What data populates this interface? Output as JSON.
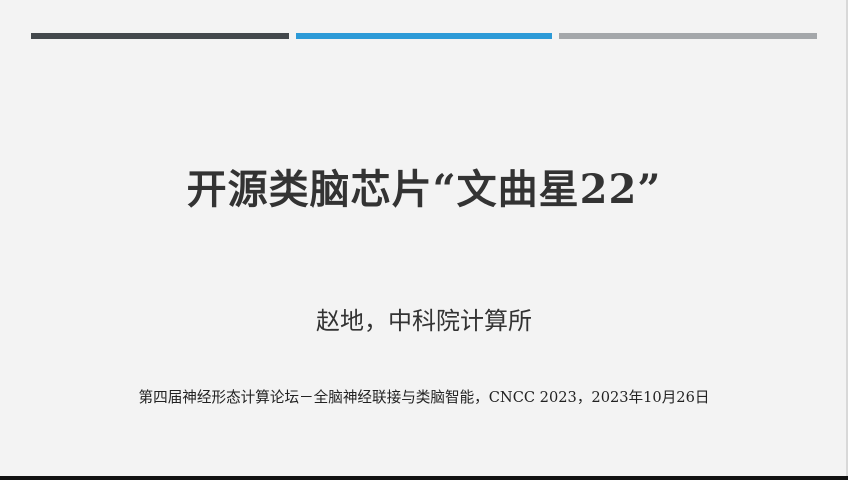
{
  "slide": {
    "title": "开源类脑芯片“文曲星22”",
    "author": "赵地，中科院计算所",
    "event": "第四届神经形态计算论坛－全脑神经联接与类脑智能，CNCC 2023，2023年10月26日"
  },
  "colors": {
    "bar_dark": "#43484c",
    "bar_blue": "#2c9ad7",
    "bar_gray": "#a4a7aa",
    "background": "#f3f3f3",
    "text": "#333333"
  }
}
